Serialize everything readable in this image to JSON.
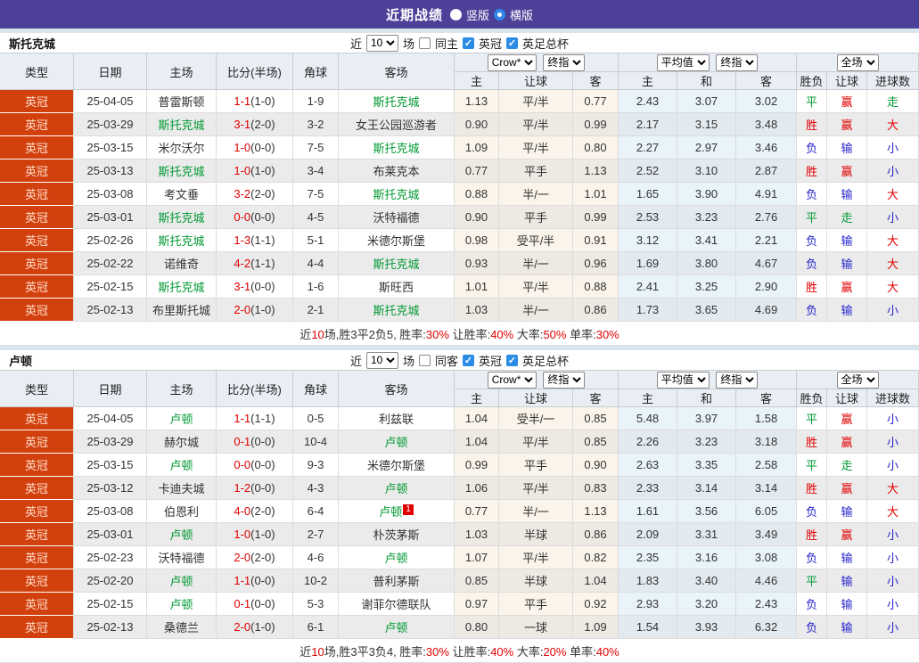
{
  "colors": {
    "accent_purple": "#4c4099",
    "type_badge_bg": "#d2400e",
    "win_red": "#e10000",
    "lose_blue": "#2525cd",
    "draw_green": "#009933"
  },
  "title_bar": {
    "title": "近期战绩",
    "radio_vertical": "竖版",
    "radio_horizontal": "横版"
  },
  "header": {
    "cols": [
      "类型",
      "日期",
      "主场",
      "比分(半场)",
      "角球",
      "客场"
    ],
    "sub": [
      "主",
      "让球",
      "客",
      "主",
      "和",
      "客",
      "胜负",
      "让球",
      "进球数"
    ],
    "selects": {
      "bookmaker": "Crow*",
      "final1": "终指",
      "average": "平均值",
      "final2": "终指",
      "scope": "全场"
    }
  },
  "sections": [
    {
      "team": "斯托克城",
      "filter": {
        "near": "近",
        "count": "10",
        "games": "场",
        "same": "同主",
        "league1": "英冠",
        "league2": "英足总杯"
      },
      "rows": [
        {
          "type": "英冠",
          "date": "25-04-05",
          "home": "普雷斯顿",
          "hg": false,
          "ft": "1-1",
          "ht": "(1-0)",
          "corner": "1-9",
          "away": "斯托克城",
          "ag": true,
          "badge": "",
          "crow": [
            "1.13",
            "平/半",
            "0.77"
          ],
          "avg": [
            "2.43",
            "3.07",
            "3.02"
          ],
          "res": [
            [
              "平",
              "g"
            ],
            [
              "赢",
              "r"
            ],
            [
              "走",
              "g"
            ]
          ]
        },
        {
          "type": "英冠",
          "date": "25-03-29",
          "home": "斯托克城",
          "hg": true,
          "ft": "3-1",
          "ht": "(2-0)",
          "corner": "3-2",
          "away": "女王公园巡游者",
          "ag": false,
          "badge": "",
          "crow": [
            "0.90",
            "平/半",
            "0.99"
          ],
          "avg": [
            "2.17",
            "3.15",
            "3.48"
          ],
          "res": [
            [
              "胜",
              "r"
            ],
            [
              "赢",
              "r"
            ],
            [
              "大",
              "r"
            ]
          ]
        },
        {
          "type": "英冠",
          "date": "25-03-15",
          "home": "米尔沃尔",
          "hg": false,
          "ft": "1-0",
          "ht": "(0-0)",
          "corner": "7-5",
          "away": "斯托克城",
          "ag": true,
          "badge": "",
          "crow": [
            "1.09",
            "平/半",
            "0.80"
          ],
          "avg": [
            "2.27",
            "2.97",
            "3.46"
          ],
          "res": [
            [
              "负",
              "b"
            ],
            [
              "输",
              "b"
            ],
            [
              "小",
              "b"
            ]
          ]
        },
        {
          "type": "英冠",
          "date": "25-03-13",
          "home": "斯托克城",
          "hg": true,
          "ft": "1-0",
          "ht": "(1-0)",
          "corner": "3-4",
          "away": "布莱克本",
          "ag": false,
          "badge": "",
          "crow": [
            "0.77",
            "平手",
            "1.13"
          ],
          "avg": [
            "2.52",
            "3.10",
            "2.87"
          ],
          "res": [
            [
              "胜",
              "r"
            ],
            [
              "赢",
              "r"
            ],
            [
              "小",
              "b"
            ]
          ]
        },
        {
          "type": "英冠",
          "date": "25-03-08",
          "home": "考文垂",
          "hg": false,
          "ft": "3-2",
          "ht": "(2-0)",
          "corner": "7-5",
          "away": "斯托克城",
          "ag": true,
          "badge": "",
          "crow": [
            "0.88",
            "半/一",
            "1.01"
          ],
          "avg": [
            "1.65",
            "3.90",
            "4.91"
          ],
          "res": [
            [
              "负",
              "b"
            ],
            [
              "输",
              "b"
            ],
            [
              "大",
              "r"
            ]
          ]
        },
        {
          "type": "英冠",
          "date": "25-03-01",
          "home": "斯托克城",
          "hg": true,
          "ft": "0-0",
          "ht": "(0-0)",
          "corner": "4-5",
          "away": "沃特福德",
          "ag": false,
          "badge": "",
          "crow": [
            "0.90",
            "平手",
            "0.99"
          ],
          "avg": [
            "2.53",
            "3.23",
            "2.76"
          ],
          "res": [
            [
              "平",
              "g"
            ],
            [
              "走",
              "g"
            ],
            [
              "小",
              "b"
            ]
          ]
        },
        {
          "type": "英冠",
          "date": "25-02-26",
          "home": "斯托克城",
          "hg": true,
          "ft": "1-3",
          "ht": "(1-1)",
          "corner": "5-1",
          "away": "米德尔斯堡",
          "ag": false,
          "badge": "",
          "crow": [
            "0.98",
            "受平/半",
            "0.91"
          ],
          "avg": [
            "3.12",
            "3.41",
            "2.21"
          ],
          "res": [
            [
              "负",
              "b"
            ],
            [
              "输",
              "b"
            ],
            [
              "大",
              "r"
            ]
          ]
        },
        {
          "type": "英冠",
          "date": "25-02-22",
          "home": "诺维奇",
          "hg": false,
          "ft": "4-2",
          "ht": "(1-1)",
          "corner": "4-4",
          "away": "斯托克城",
          "ag": true,
          "badge": "",
          "crow": [
            "0.93",
            "半/一",
            "0.96"
          ],
          "avg": [
            "1.69",
            "3.80",
            "4.67"
          ],
          "res": [
            [
              "负",
              "b"
            ],
            [
              "输",
              "b"
            ],
            [
              "大",
              "r"
            ]
          ]
        },
        {
          "type": "英冠",
          "date": "25-02-15",
          "home": "斯托克城",
          "hg": true,
          "ft": "3-1",
          "ht": "(0-0)",
          "corner": "1-6",
          "away": "斯旺西",
          "ag": false,
          "badge": "",
          "crow": [
            "1.01",
            "平/半",
            "0.88"
          ],
          "avg": [
            "2.41",
            "3.25",
            "2.90"
          ],
          "res": [
            [
              "胜",
              "r"
            ],
            [
              "赢",
              "r"
            ],
            [
              "大",
              "r"
            ]
          ]
        },
        {
          "type": "英冠",
          "date": "25-02-13",
          "home": "布里斯托城",
          "hg": false,
          "ft": "2-0",
          "ht": "(1-0)",
          "corner": "2-1",
          "away": "斯托克城",
          "ag": true,
          "badge": "",
          "crow": [
            "1.03",
            "半/一",
            "0.86"
          ],
          "avg": [
            "1.73",
            "3.65",
            "4.69"
          ],
          "res": [
            [
              "负",
              "b"
            ],
            [
              "输",
              "b"
            ],
            [
              "小",
              "b"
            ]
          ]
        }
      ],
      "summary": [
        [
          "近",
          0
        ],
        [
          "10",
          1
        ],
        [
          "场,胜3平2负5, 胜率:",
          0
        ],
        [
          "30%",
          1
        ],
        [
          " 让胜率:",
          0
        ],
        [
          "40%",
          1
        ],
        [
          " 大率:",
          0
        ],
        [
          "50%",
          1
        ],
        [
          " 单率:",
          0
        ],
        [
          "30%",
          1
        ]
      ]
    },
    {
      "team": "卢顿",
      "filter": {
        "near": "近",
        "count": "10",
        "games": "场",
        "same": "同客",
        "league1": "英冠",
        "league2": "英足总杯"
      },
      "rows": [
        {
          "type": "英冠",
          "date": "25-04-05",
          "home": "卢顿",
          "hg": true,
          "ft": "1-1",
          "ht": "(1-1)",
          "corner": "0-5",
          "away": "利兹联",
          "ag": false,
          "badge": "",
          "crow": [
            "1.04",
            "受半/一",
            "0.85"
          ],
          "avg": [
            "5.48",
            "3.97",
            "1.58"
          ],
          "res": [
            [
              "平",
              "g"
            ],
            [
              "赢",
              "r"
            ],
            [
              "小",
              "b"
            ]
          ]
        },
        {
          "type": "英冠",
          "date": "25-03-29",
          "home": "赫尔城",
          "hg": false,
          "ft": "0-1",
          "ht": "(0-0)",
          "corner": "10-4",
          "away": "卢顿",
          "ag": true,
          "badge": "",
          "crow": [
            "1.04",
            "平/半",
            "0.85"
          ],
          "avg": [
            "2.26",
            "3.23",
            "3.18"
          ],
          "res": [
            [
              "胜",
              "r"
            ],
            [
              "赢",
              "r"
            ],
            [
              "小",
              "b"
            ]
          ]
        },
        {
          "type": "英冠",
          "date": "25-03-15",
          "home": "卢顿",
          "hg": true,
          "ft": "0-0",
          "ht": "(0-0)",
          "corner": "9-3",
          "away": "米德尔斯堡",
          "ag": false,
          "badge": "",
          "crow": [
            "0.99",
            "平手",
            "0.90"
          ],
          "avg": [
            "2.63",
            "3.35",
            "2.58"
          ],
          "res": [
            [
              "平",
              "g"
            ],
            [
              "走",
              "g"
            ],
            [
              "小",
              "b"
            ]
          ]
        },
        {
          "type": "英冠",
          "date": "25-03-12",
          "home": "卡迪夫城",
          "hg": false,
          "ft": "1-2",
          "ht": "(0-0)",
          "corner": "4-3",
          "away": "卢顿",
          "ag": true,
          "badge": "",
          "crow": [
            "1.06",
            "平/半",
            "0.83"
          ],
          "avg": [
            "2.33",
            "3.14",
            "3.14"
          ],
          "res": [
            [
              "胜",
              "r"
            ],
            [
              "赢",
              "r"
            ],
            [
              "大",
              "r"
            ]
          ]
        },
        {
          "type": "英冠",
          "date": "25-03-08",
          "home": "伯恩利",
          "hg": false,
          "ft": "4-0",
          "ht": "(2-0)",
          "corner": "6-4",
          "away": "卢顿",
          "ag": true,
          "badge": "1",
          "crow": [
            "0.77",
            "半/一",
            "1.13"
          ],
          "avg": [
            "1.61",
            "3.56",
            "6.05"
          ],
          "res": [
            [
              "负",
              "b"
            ],
            [
              "输",
              "b"
            ],
            [
              "大",
              "r"
            ]
          ]
        },
        {
          "type": "英冠",
          "date": "25-03-01",
          "home": "卢顿",
          "hg": true,
          "ft": "1-0",
          "ht": "(1-0)",
          "corner": "2-7",
          "away": "朴茨茅斯",
          "ag": false,
          "badge": "",
          "crow": [
            "1.03",
            "半球",
            "0.86"
          ],
          "avg": [
            "2.09",
            "3.31",
            "3.49"
          ],
          "res": [
            [
              "胜",
              "r"
            ],
            [
              "赢",
              "r"
            ],
            [
              "小",
              "b"
            ]
          ]
        },
        {
          "type": "英冠",
          "date": "25-02-23",
          "home": "沃特福德",
          "hg": false,
          "ft": "2-0",
          "ht": "(2-0)",
          "corner": "4-6",
          "away": "卢顿",
          "ag": true,
          "badge": "",
          "crow": [
            "1.07",
            "平/半",
            "0.82"
          ],
          "avg": [
            "2.35",
            "3.16",
            "3.08"
          ],
          "res": [
            [
              "负",
              "b"
            ],
            [
              "输",
              "b"
            ],
            [
              "小",
              "b"
            ]
          ]
        },
        {
          "type": "英冠",
          "date": "25-02-20",
          "home": "卢顿",
          "hg": true,
          "ft": "1-1",
          "ht": "(0-0)",
          "corner": "10-2",
          "away": "普利茅斯",
          "ag": false,
          "badge": "",
          "crow": [
            "0.85",
            "半球",
            "1.04"
          ],
          "avg": [
            "1.83",
            "3.40",
            "4.46"
          ],
          "res": [
            [
              "平",
              "g"
            ],
            [
              "输",
              "b"
            ],
            [
              "小",
              "b"
            ]
          ]
        },
        {
          "type": "英冠",
          "date": "25-02-15",
          "home": "卢顿",
          "hg": true,
          "ft": "0-1",
          "ht": "(0-0)",
          "corner": "5-3",
          "away": "谢菲尔德联队",
          "ag": false,
          "badge": "",
          "crow": [
            "0.97",
            "平手",
            "0.92"
          ],
          "avg": [
            "2.93",
            "3.20",
            "2.43"
          ],
          "res": [
            [
              "负",
              "b"
            ],
            [
              "输",
              "b"
            ],
            [
              "小",
              "b"
            ]
          ]
        },
        {
          "type": "英冠",
          "date": "25-02-13",
          "home": "桑德兰",
          "hg": false,
          "ft": "2-0",
          "ht": "(1-0)",
          "corner": "6-1",
          "away": "卢顿",
          "ag": true,
          "badge": "",
          "crow": [
            "0.80",
            "一球",
            "1.09"
          ],
          "avg": [
            "1.54",
            "3.93",
            "6.32"
          ],
          "res": [
            [
              "负",
              "b"
            ],
            [
              "输",
              "b"
            ],
            [
              "小",
              "b"
            ]
          ]
        }
      ],
      "summary": [
        [
          "近",
          0
        ],
        [
          "10",
          1
        ],
        [
          "场,胜3平3负4, 胜率:",
          0
        ],
        [
          "30%",
          1
        ],
        [
          " 让胜率:",
          0
        ],
        [
          "40%",
          1
        ],
        [
          " 大率:",
          0
        ],
        [
          "20%",
          1
        ],
        [
          " 单率:",
          0
        ],
        [
          "40%",
          1
        ]
      ]
    }
  ]
}
